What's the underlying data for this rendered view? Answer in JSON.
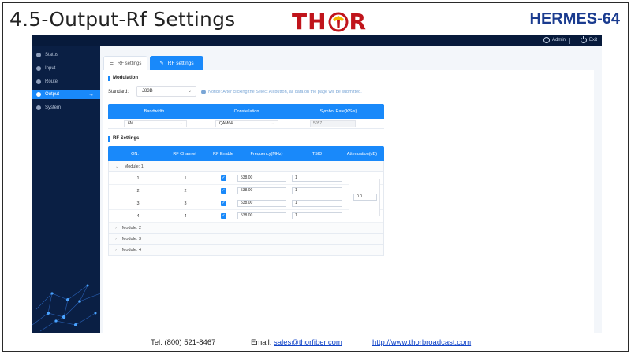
{
  "slide": {
    "title": "4.5-Output-Rf Settings",
    "logo_left": "TH",
    "logo_right": "R",
    "model": "HERMES-64"
  },
  "topbar": {
    "user": "Admin",
    "exit": "Exit"
  },
  "sidebar": {
    "items": [
      {
        "label": "Status",
        "active": false
      },
      {
        "label": "Input",
        "active": false
      },
      {
        "label": "Route",
        "active": false
      },
      {
        "label": "Output",
        "active": true,
        "arrow": "→"
      },
      {
        "label": "System",
        "active": false
      }
    ]
  },
  "tabs": [
    {
      "label": "RF settings",
      "active": false
    },
    {
      "label": "RF settings",
      "active": true
    }
  ],
  "modulation": {
    "section_title": "Modulation",
    "standard_label": "Standard:",
    "standard_value": "J83B",
    "notice": "Notice:  After clicking the Select All button, all data on the page will be submitted.",
    "headers": [
      "Bandwidth",
      "Constellation",
      "Symbol Rate(KS/s)"
    ],
    "bandwidth": "6M",
    "constellation": "QAM64",
    "symbol_rate": "5057"
  },
  "rf": {
    "section_title": "RF Settings",
    "headers": [
      "ON.",
      "RF Channel",
      "RF Enable",
      "Frequency(MHz)",
      "TSID",
      "Attenuation(dB)"
    ],
    "module1_label": "Module: 1",
    "rows": [
      {
        "on": "1",
        "channel": "1",
        "frequency": "538.00",
        "tsid": "1"
      },
      {
        "on": "2",
        "channel": "2",
        "frequency": "538.00",
        "tsid": "1"
      },
      {
        "on": "3",
        "channel": "3",
        "frequency": "538.00",
        "tsid": "1"
      },
      {
        "on": "4",
        "channel": "4",
        "frequency": "538.00",
        "tsid": "1"
      }
    ],
    "attenuation": "0.0",
    "collapsed_modules": [
      "Module: 2",
      "Module: 3",
      "Module: 4"
    ]
  },
  "footer": {
    "tel": "Tel: (800) 521-8467",
    "email_label": "Email: ",
    "email": "sales@thorfiber.com",
    "url": "http://www.thorbroadcast.com"
  }
}
